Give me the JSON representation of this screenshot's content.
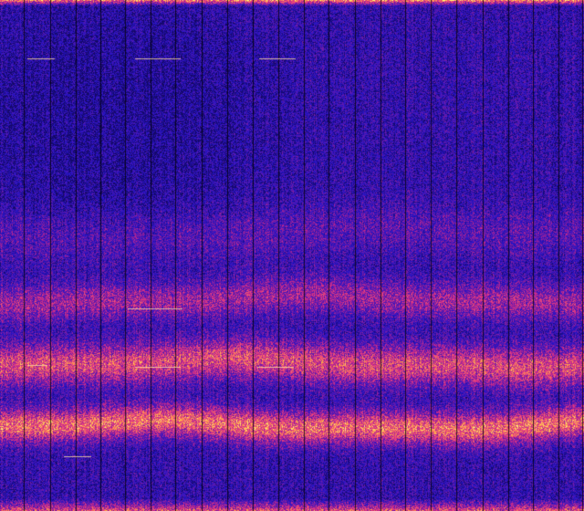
{
  "image": {
    "kind": "spectrogram",
    "colormap": "plasma-like",
    "palette": {
      "background_low": "#1a0c7a",
      "blue": "#2a18c8",
      "violet": "#6a1aa8",
      "magenta": "#c82890",
      "pink": "#f05080",
      "orange": "#ff9a40",
      "yellow": "#ffe870",
      "column_gap": "#000000"
    },
    "column_gaps_visible": true,
    "top_edge_highlight": true,
    "bottom_edge_highlight": true,
    "bands": [
      {
        "name": "upper-band",
        "relative_intensity": 0.25
      },
      {
        "name": "mid-upper-band",
        "relative_intensity": 0.55
      },
      {
        "name": "middle-band",
        "relative_intensity": 0.85
      },
      {
        "name": "lower-band",
        "relative_intensity": 1.0
      }
    ]
  }
}
